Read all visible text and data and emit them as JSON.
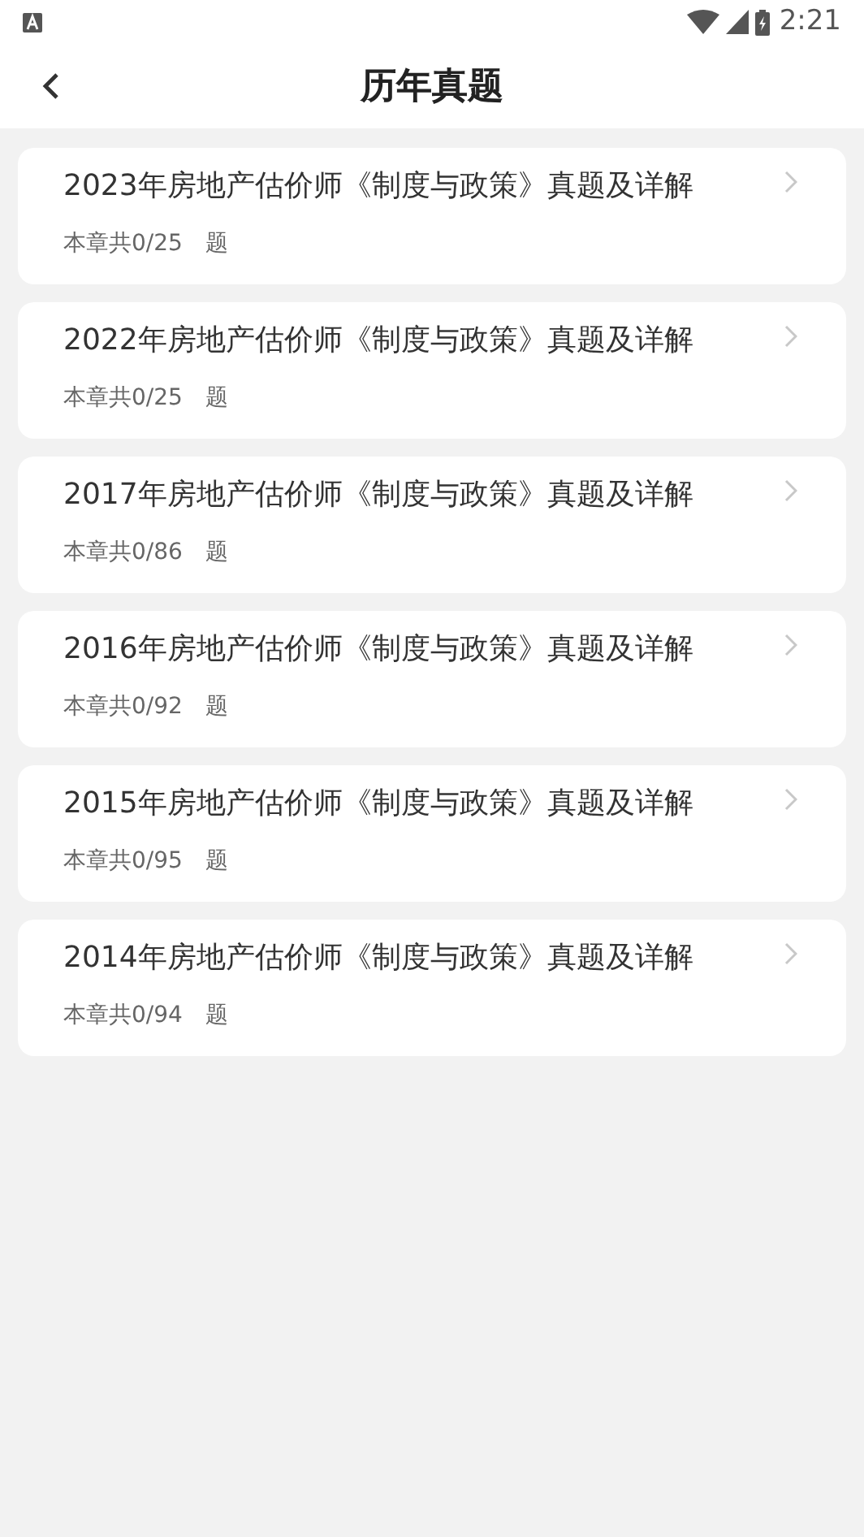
{
  "status_bar": {
    "time": "2:21"
  },
  "header": {
    "title": "历年真题"
  },
  "papers": [
    {
      "title": "2023年房地产估价师《制度与政策》真题及详解",
      "count": "本章共0/25",
      "unit": "题"
    },
    {
      "title": "2022年房地产估价师《制度与政策》真题及详解",
      "count": "本章共0/25",
      "unit": "题"
    },
    {
      "title": "2017年房地产估价师《制度与政策》真题及详解",
      "count": "本章共0/86",
      "unit": "题"
    },
    {
      "title": "2016年房地产估价师《制度与政策》真题及详解",
      "count": "本章共0/92",
      "unit": "题"
    },
    {
      "title": "2015年房地产估价师《制度与政策》真题及详解",
      "count": "本章共0/95",
      "unit": "题"
    },
    {
      "title": "2014年房地产估价师《制度与政策》真题及详解",
      "count": "本章共0/94",
      "unit": "题"
    }
  ]
}
